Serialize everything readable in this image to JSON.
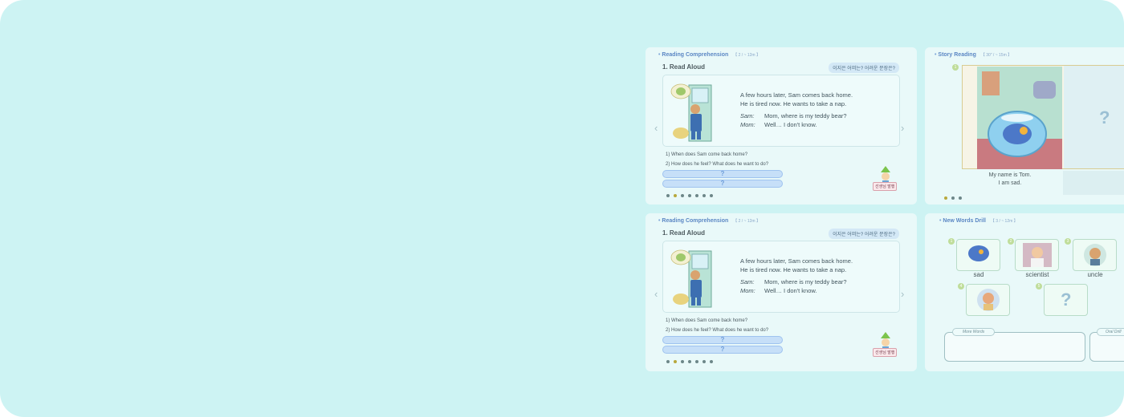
{
  "cards": [
    {
      "header": "Reading Comprehension",
      "header_mini": "【 2 / ~ 12m 】",
      "section": "1. Read Aloud",
      "pill": "이지은 어떠는? 어려운 문장은?",
      "lines": [
        "A few hours later, Sam comes back home.",
        "He is tired now. He wants to take a nap."
      ],
      "dialog": [
        {
          "speaker": "Sam:",
          "text": "Mom, where is my teddy bear?"
        },
        {
          "speaker": "Mom:",
          "text": "Well… I don't know."
        }
      ],
      "questions": [
        "1) When does Sam come back home?",
        "2) How does he feel? What does he want to do?"
      ],
      "answers": [
        "?",
        "?"
      ],
      "teacher_label": "선생님 발행"
    },
    {
      "header": "Reading Comprehension",
      "header_mini": "【 2 / ~ 12m 】",
      "section": "1. Read Aloud",
      "pill": "이지은 어떠는? 어려운 문장은?",
      "lines": [
        "A few hours later, Sam comes back home.",
        "He is tired now. He wants to take a nap."
      ],
      "dialog": [
        {
          "speaker": "Sam:",
          "text": "Mom, where is my teddy bear?"
        },
        {
          "speaker": "Mom:",
          "text": "Well… I don't know."
        }
      ],
      "questions": [
        "1) When does Sam come back home?",
        "2) How does he feel? What does he want to do?"
      ],
      "answers": [
        "?",
        "?"
      ],
      "teacher_label": "선생님 발행"
    }
  ],
  "story": {
    "header": "Story Reading",
    "header_mini": "【 30\" / ~ 15m 】",
    "caption": [
      "My name is Tom.",
      "I am sad."
    ],
    "page_num": "1",
    "mystery": "?"
  },
  "drill": {
    "header": "New Words Drill",
    "header_mini": "【 3 / ~ 12m 】",
    "words": [
      "sad",
      "scientist",
      "uncle"
    ],
    "word_nums": [
      "1",
      "2",
      "3",
      "4",
      "5"
    ],
    "mystery": "?",
    "more_words": "More Words",
    "oral_drill": "Oral Drill"
  }
}
